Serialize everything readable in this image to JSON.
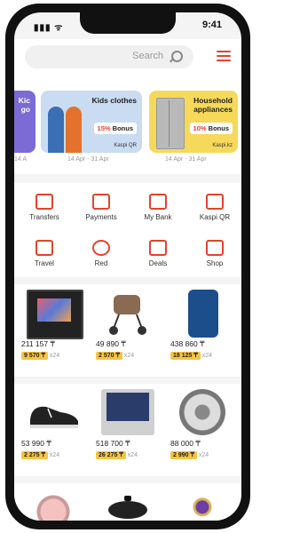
{
  "status": {
    "time": "9:41",
    "indicators": "▮▮▮ ᯤ"
  },
  "search": {
    "placeholder": "Search"
  },
  "banners": [
    {
      "title": "Household appliances",
      "bonus_pct": "10%",
      "bonus_word": "Bonus",
      "payment": "Kaspi.kz",
      "date": "14 Apr - 31 Apr"
    },
    {
      "title": "Kids clothes",
      "bonus_pct": "15%",
      "bonus_word": "Bonus",
      "payment": "Kaspi QR",
      "date": "14 Apr - 31 Apr"
    },
    {
      "title": "Kic go",
      "date": "14 A"
    }
  ],
  "services": [
    {
      "label": "Kaspi QR",
      "icon": "qr-icon"
    },
    {
      "label": "My Bank",
      "icon": "bank-icon"
    },
    {
      "label": "Payments",
      "icon": "payments-icon"
    },
    {
      "label": "Transfers",
      "icon": "transfers-icon"
    },
    {
      "label": "Shop",
      "icon": "cart-icon"
    },
    {
      "label": "Deals",
      "icon": "gift-icon"
    },
    {
      "label": "Red",
      "icon": "red-icon"
    },
    {
      "label": "Travel",
      "icon": "travel-icon"
    }
  ],
  "row1": [
    {
      "price": "438 860 ₸",
      "inst": "18 125 ₸",
      "months": "x24",
      "name": "phone"
    },
    {
      "price": "49 890 ₸",
      "inst": "2 570 ₸",
      "months": "x24",
      "name": "stroller"
    },
    {
      "price": "211 157 ₸",
      "inst": "9 570 ₸",
      "months": "x24",
      "name": "tv"
    }
  ],
  "row2": [
    {
      "price": "88 000 ₸",
      "inst": "2 990 ₸",
      "months": "x24",
      "name": "wheel"
    },
    {
      "price": "518 700 ₸",
      "inst": "26 275 ₸",
      "months": "x24",
      "name": "laptop"
    },
    {
      "price": "53 990 ₸",
      "inst": "2 275 ₸",
      "months": "x24",
      "name": "sneaker"
    }
  ],
  "row3": [
    {
      "name": "ring"
    },
    {
      "name": "pan"
    },
    {
      "name": "watch"
    }
  ],
  "colors": {
    "accent": "#e5422c",
    "bonus": "#f6c443"
  }
}
